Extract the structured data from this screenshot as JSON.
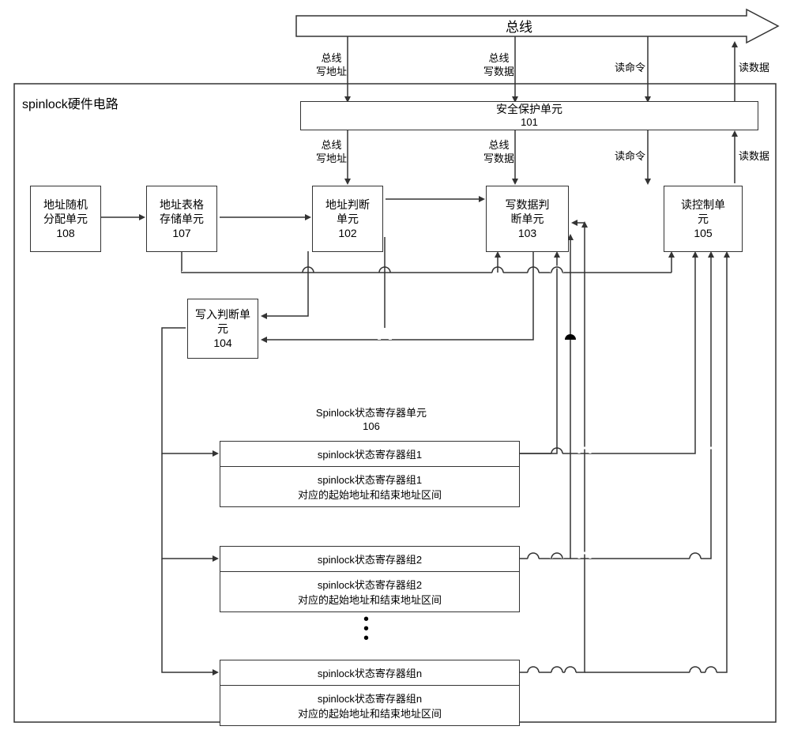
{
  "bus": {
    "label": "总线"
  },
  "labels": {
    "write_addr": "总线\n写地址",
    "write_data": "总线\n写数据",
    "read_cmd": "读命令",
    "read_data": "读数据"
  },
  "circuit_title": "spinlock硬件电路",
  "blocks": {
    "b101": {
      "name": "安全保护单元",
      "num": "101"
    },
    "b102": {
      "name": "地址判断\n单元",
      "num": "102"
    },
    "b103": {
      "name": "写数据判\n断单元",
      "num": "103"
    },
    "b104": {
      "name": "写入判断单\n元",
      "num": "104"
    },
    "b105": {
      "name": "读控制单\n元",
      "num": "105"
    },
    "b106": {
      "name": "Spinlock状态寄存器单元",
      "num": "106"
    },
    "b107": {
      "name": "地址表格\n存储单元",
      "num": "107"
    },
    "b108": {
      "name": "地址随机\n分配单元",
      "num": "108"
    }
  },
  "reg": {
    "g1": {
      "t": "spinlock状态寄存器组1",
      "b": "spinlock状态寄存器组1\n对应的起始地址和结束地址区间"
    },
    "g2": {
      "t": "spinlock状态寄存器组2",
      "b": "spinlock状态寄存器组2\n对应的起始地址和结束地址区间"
    },
    "gn": {
      "t": "spinlock状态寄存器组n",
      "b": "spinlock状态寄存器组n\n对应的起始地址和结束地址区间"
    }
  }
}
